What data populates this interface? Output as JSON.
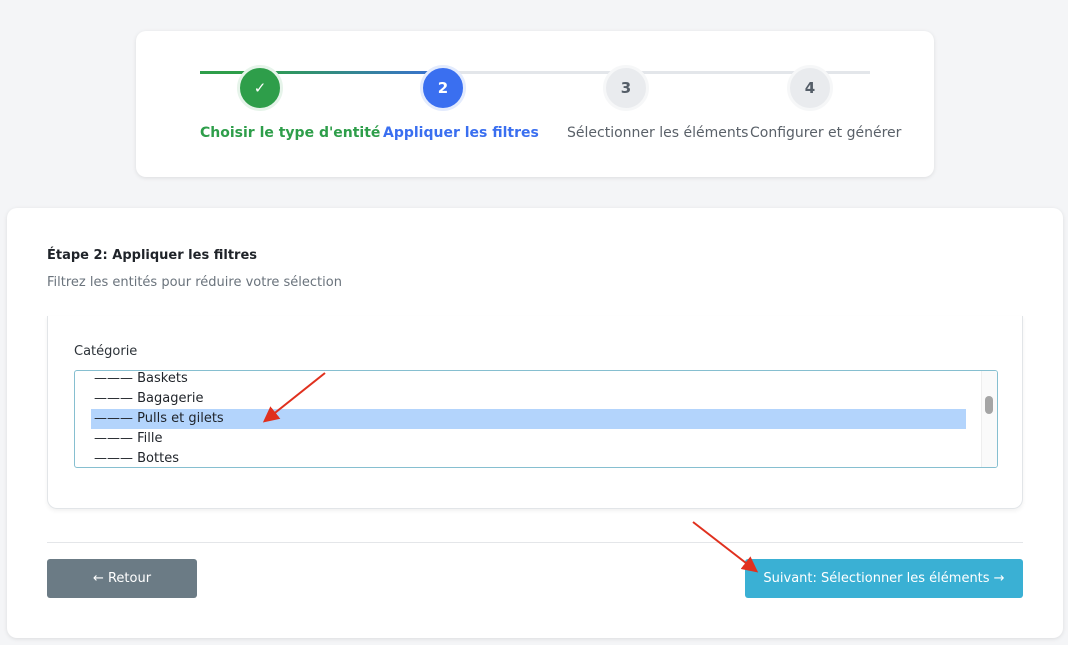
{
  "stepper": {
    "steps": [
      {
        "number": "✓",
        "label": "Choisir le type d'entité",
        "state": "done"
      },
      {
        "number": "2",
        "label": "Appliquer les filtres",
        "state": "active"
      },
      {
        "number": "3",
        "label": "Sélectionner les éléments",
        "state": "todo"
      },
      {
        "number": "4",
        "label": "Configurer et générer",
        "state": "todo"
      }
    ]
  },
  "main": {
    "title": "Étape 2: Appliquer les filtres",
    "subtitle": "Filtrez les entités pour réduire votre sélection",
    "filter": {
      "label": "Catégorie",
      "options": [
        {
          "text": "——— Baskets",
          "selected": false
        },
        {
          "text": "——— Bagagerie",
          "selected": false
        },
        {
          "text": "——— Pulls et gilets",
          "selected": true
        },
        {
          "text": "——— Fille",
          "selected": false
        },
        {
          "text": "——— Bottes",
          "selected": false
        }
      ]
    },
    "back_button": "← Retour",
    "next_button": "Suivant: Sélectionner les éléments →"
  },
  "colors": {
    "done": "#2e9e4a",
    "active": "#3a6ff0",
    "next_button": "#3ab0d4",
    "back_button": "#6b7b85",
    "selection": "#b3d4fc",
    "annotation_arrow": "#e0301e"
  }
}
